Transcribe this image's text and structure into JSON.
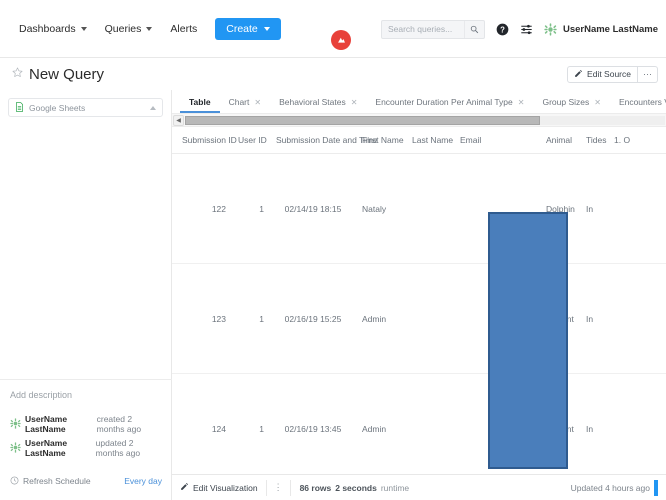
{
  "topnav": {
    "items": [
      {
        "label": "Dashboards",
        "caret": true,
        "icon": "chevron-down-icon"
      },
      {
        "label": "Queries",
        "caret": true,
        "icon": "chevron-down-icon"
      },
      {
        "label": "Alerts",
        "caret": false,
        "icon": ""
      }
    ],
    "create_label": "Create",
    "logo_name": "redash-logo-icon",
    "logo_color": "#e8413a",
    "create_color": "#2196f3"
  },
  "search": {
    "placeholder": "Search queries...",
    "value": "",
    "button_icon": "search-icon"
  },
  "header_icons": {
    "help": "help-circle-icon",
    "settings": "sliders-icon",
    "avatar": "user-avatar-icon"
  },
  "user": {
    "name": "UserName LastName"
  },
  "title": {
    "star_icon": "star-outline-icon",
    "text": "New Query",
    "edit_source_label": "Edit Source",
    "edit_source_icon": "pencil-square-icon",
    "more_label": "···"
  },
  "sidebar": {
    "data_source": {
      "label": "Google Sheets",
      "icon": "sheets-document-icon",
      "chevron": "chevron-up-icon"
    },
    "add_description": "Add description",
    "meta": [
      {
        "name": "UserName LastName",
        "text": "created 2 months ago",
        "icon": "user-avatar-icon"
      },
      {
        "name": "UserName LastName",
        "text": "updated 2 months ago",
        "icon": "user-avatar-icon"
      }
    ],
    "refresh": {
      "icon": "clock-icon",
      "label": "Refresh Schedule",
      "value": "Every day",
      "value_color": "#4a90d9"
    }
  },
  "tabs": [
    {
      "label": "Table",
      "closable": false,
      "active": true
    },
    {
      "label": "Chart",
      "closable": true,
      "active": false
    },
    {
      "label": "Behavioral States",
      "closable": true,
      "active": false
    },
    {
      "label": "Encounter Duration Per Animal Type",
      "closable": true,
      "active": false
    },
    {
      "label": "Group Sizes",
      "closable": true,
      "active": false
    },
    {
      "label": "Encounters Vs Salinity And Water Temp",
      "closable": true,
      "active": false
    }
  ],
  "scrollbar": {
    "left_arrow": "◀",
    "thumb_width_pct": 74
  },
  "table": {
    "columns": [
      {
        "key": "submission_id",
        "label": "Submission ID"
      },
      {
        "key": "user_id",
        "label": "User ID"
      },
      {
        "key": "submission_datetime",
        "label": "Submission Date and Time"
      },
      {
        "key": "first_name",
        "label": "First Name"
      },
      {
        "key": "last_name",
        "label": "Last Name"
      },
      {
        "key": "email",
        "label": "Email"
      },
      {
        "key": "animal",
        "label": "Animal"
      },
      {
        "key": "tides",
        "label": "Tides"
      },
      {
        "key": "other",
        "label": "1. O"
      }
    ],
    "rows": [
      {
        "submission_id": "122",
        "user_id": "1",
        "submission_datetime": "02/14/19 18:15",
        "first_name": "Nataly",
        "last_name": "",
        "email": "",
        "animal": "Dolphin",
        "tides": "In",
        "other": ""
      },
      {
        "submission_id": "123",
        "user_id": "1",
        "submission_datetime": "02/16/19 15:25",
        "first_name": "Admin",
        "last_name": "",
        "email": "",
        "animal": "E-Point",
        "tides": "In",
        "other": ""
      },
      {
        "submission_id": "124",
        "user_id": "1",
        "submission_datetime": "02/16/19 13:45",
        "first_name": "Admin",
        "last_name": "",
        "email": "",
        "animal": "E-Point",
        "tides": "In",
        "other": ""
      }
    ]
  },
  "selection_overlay": {
    "fill": "#4a7ebb",
    "border": "#2f5b8f"
  },
  "statusbar": {
    "edit_visualization_label": "Edit Visualization",
    "edit_visualization_icon": "pencil-square-icon",
    "more_icon": "vertical-dots-icon",
    "row_count": "86 rows",
    "runtime_value": "2 seconds",
    "runtime_label": "runtime",
    "updated": "Updated 4 hours ago"
  }
}
